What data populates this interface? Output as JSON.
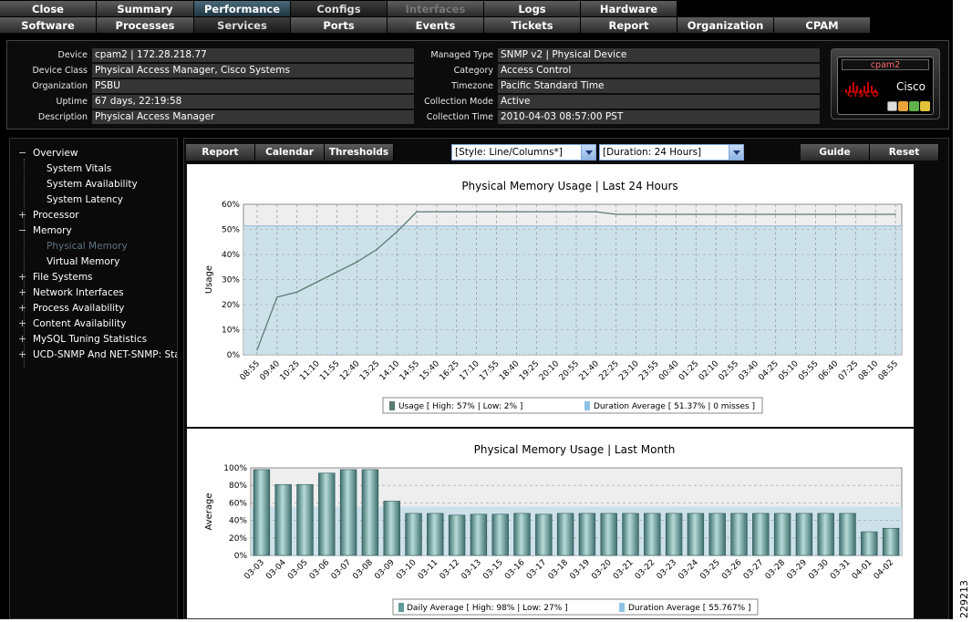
{
  "nav": {
    "row1": [
      {
        "label": "Close",
        "state": "normal"
      },
      {
        "label": "Summary",
        "state": "normal"
      },
      {
        "label": "Performance",
        "state": "active"
      },
      {
        "label": "Configs",
        "state": "sel2"
      },
      {
        "label": "Interfaces",
        "state": "disabled"
      },
      {
        "label": "Logs",
        "state": "normal"
      },
      {
        "label": "Hardware",
        "state": "normal"
      }
    ],
    "row2": [
      {
        "label": "Software",
        "state": "normal"
      },
      {
        "label": "Processes",
        "state": "normal"
      },
      {
        "label": "Services",
        "state": "sel2"
      },
      {
        "label": "Ports",
        "state": "normal"
      },
      {
        "label": "Events",
        "state": "normal"
      },
      {
        "label": "Tickets",
        "state": "normal"
      },
      {
        "label": "Report",
        "state": "normal"
      },
      {
        "label": "Organization",
        "state": "normal"
      },
      {
        "label": "CPAM",
        "state": "normal"
      }
    ]
  },
  "device_info": {
    "left": [
      {
        "label": "Device",
        "value": "cpam2 | 172.28.218.77"
      },
      {
        "label": "Device Class",
        "value": "Physical Access Manager, Cisco Systems"
      },
      {
        "label": "Organization",
        "value": "PSBU"
      },
      {
        "label": "Uptime",
        "value": "67 days, 22:19:58"
      },
      {
        "label": "Description",
        "value": "Physical Access Manager"
      }
    ],
    "right": [
      {
        "label": "Managed Type",
        "value": "SNMP v2 | Physical Device"
      },
      {
        "label": "Category",
        "value": "Access Control"
      },
      {
        "label": "Timezone",
        "value": "Pacific Standard Time"
      },
      {
        "label": "Collection Mode",
        "value": "Active"
      },
      {
        "label": "Collection Time",
        "value": "2010-04-03 08:57:00 PST"
      }
    ],
    "logo": {
      "hostname": "cpam2",
      "brand": "Cisco",
      "brand_mark": "CISCO"
    }
  },
  "tree": [
    {
      "label": "Overview",
      "sign": "−",
      "level": 0
    },
    {
      "label": "System Vitals",
      "level": 1
    },
    {
      "label": "System Availability",
      "level": 1
    },
    {
      "label": "System Latency",
      "level": 1
    },
    {
      "label": "Processor",
      "sign": "+",
      "level": 0
    },
    {
      "label": "Memory",
      "sign": "−",
      "level": 0
    },
    {
      "label": "Physical Memory",
      "level": 1,
      "selected": true
    },
    {
      "label": "Virtual Memory",
      "level": 1
    },
    {
      "label": "File Systems",
      "sign": "+",
      "level": 0
    },
    {
      "label": "Network Interfaces",
      "sign": "+",
      "level": 0
    },
    {
      "label": "Process Availability",
      "sign": "+",
      "level": 0
    },
    {
      "label": "Content Availability",
      "sign": "+",
      "level": 0
    },
    {
      "label": "MySQL Tuning Statistics",
      "sign": "+",
      "level": 0
    },
    {
      "label": "UCD-SNMP And NET-SNMP: Stat",
      "sign": "+",
      "level": 0
    }
  ],
  "toolbar": {
    "report": "Report",
    "calendar": "Calendar",
    "thresholds": "Thresholds",
    "style_select": "[Style: Line/Columns*]",
    "duration_select": "[Duration: 24 Hours]",
    "guide": "Guide",
    "reset": "Reset"
  },
  "chart_data": [
    {
      "type": "line",
      "title": "Physical Memory Usage |  Last 24 Hours",
      "ylabel": "Usage",
      "xlabel": "",
      "ylim": [
        0,
        60
      ],
      "yticks": [
        "0%",
        "10%",
        "20%",
        "30%",
        "40%",
        "50%",
        "60%"
      ],
      "x": [
        "08:55",
        "09:40",
        "10:25",
        "11:10",
        "11:55",
        "12:40",
        "13:25",
        "14:10",
        "14:55",
        "15:40",
        "16:25",
        "17:10",
        "17:55",
        "18:40",
        "19:25",
        "20:10",
        "20:55",
        "21:40",
        "22:25",
        "23:10",
        "23:55",
        "00:40",
        "01:25",
        "02:10",
        "02:55",
        "03:40",
        "04:25",
        "05:10",
        "05:55",
        "06:40",
        "07:25",
        "08:10",
        "08:55"
      ],
      "series": [
        {
          "name": "Usage",
          "high": "57%",
          "low": "2%",
          "values": [
            2,
            23,
            25,
            29,
            33,
            37,
            42,
            49,
            57,
            57,
            57,
            57,
            57,
            57,
            57,
            57,
            57,
            57,
            56,
            56,
            56,
            56,
            56,
            56,
            56,
            56,
            56,
            56,
            56,
            56,
            56,
            56,
            56
          ]
        }
      ],
      "duration_average": 51.37,
      "legend": {
        "series": "Usage [ High: 57% | Low: 2% ]",
        "average": "Duration Average [ 51.37% | 0 misses ]"
      },
      "grid": true,
      "legend_position": "bottom"
    },
    {
      "type": "bar",
      "title": "Physical Memory Usage | Last Month",
      "ylabel": "Average",
      "xlabel": "",
      "ylim": [
        0,
        100
      ],
      "yticks": [
        "0%",
        "20%",
        "40%",
        "60%",
        "80%",
        "100%"
      ],
      "categories": [
        "03-03",
        "03-04",
        "03-05",
        "03-06",
        "03-07",
        "03-08",
        "03-09",
        "03-10",
        "03-11",
        "03-12",
        "03-13",
        "03-15",
        "03-16",
        "03-17",
        "03-18",
        "03-19",
        "03-20",
        "03-21",
        "03-22",
        "03-23",
        "03-24",
        "03-25",
        "03-26",
        "03-27",
        "03-28",
        "03-29",
        "03-30",
        "03-31",
        "04-01",
        "04-02"
      ],
      "series": [
        {
          "name": "Daily Average",
          "high": "98%",
          "low": "27%",
          "values": [
            98,
            81,
            81,
            94,
            98,
            98,
            62,
            48,
            48,
            46,
            47,
            47,
            48,
            47,
            48,
            48,
            48,
            48,
            48,
            48,
            48,
            48,
            48,
            48,
            48,
            48,
            48,
            48,
            27,
            31
          ]
        }
      ],
      "duration_average": 55.767,
      "legend": {
        "series": "Daily Average [ High: 98% | Low: 27% ]",
        "average": "Duration Average [ 55.767% ]"
      },
      "grid": true,
      "legend_position": "bottom"
    }
  ],
  "stamp": "229213",
  "colors": {
    "line": "#5b7b73",
    "bar": "#5e9a98",
    "average_fill": "#c9dfea",
    "active_tab": "#2f4d5c"
  }
}
